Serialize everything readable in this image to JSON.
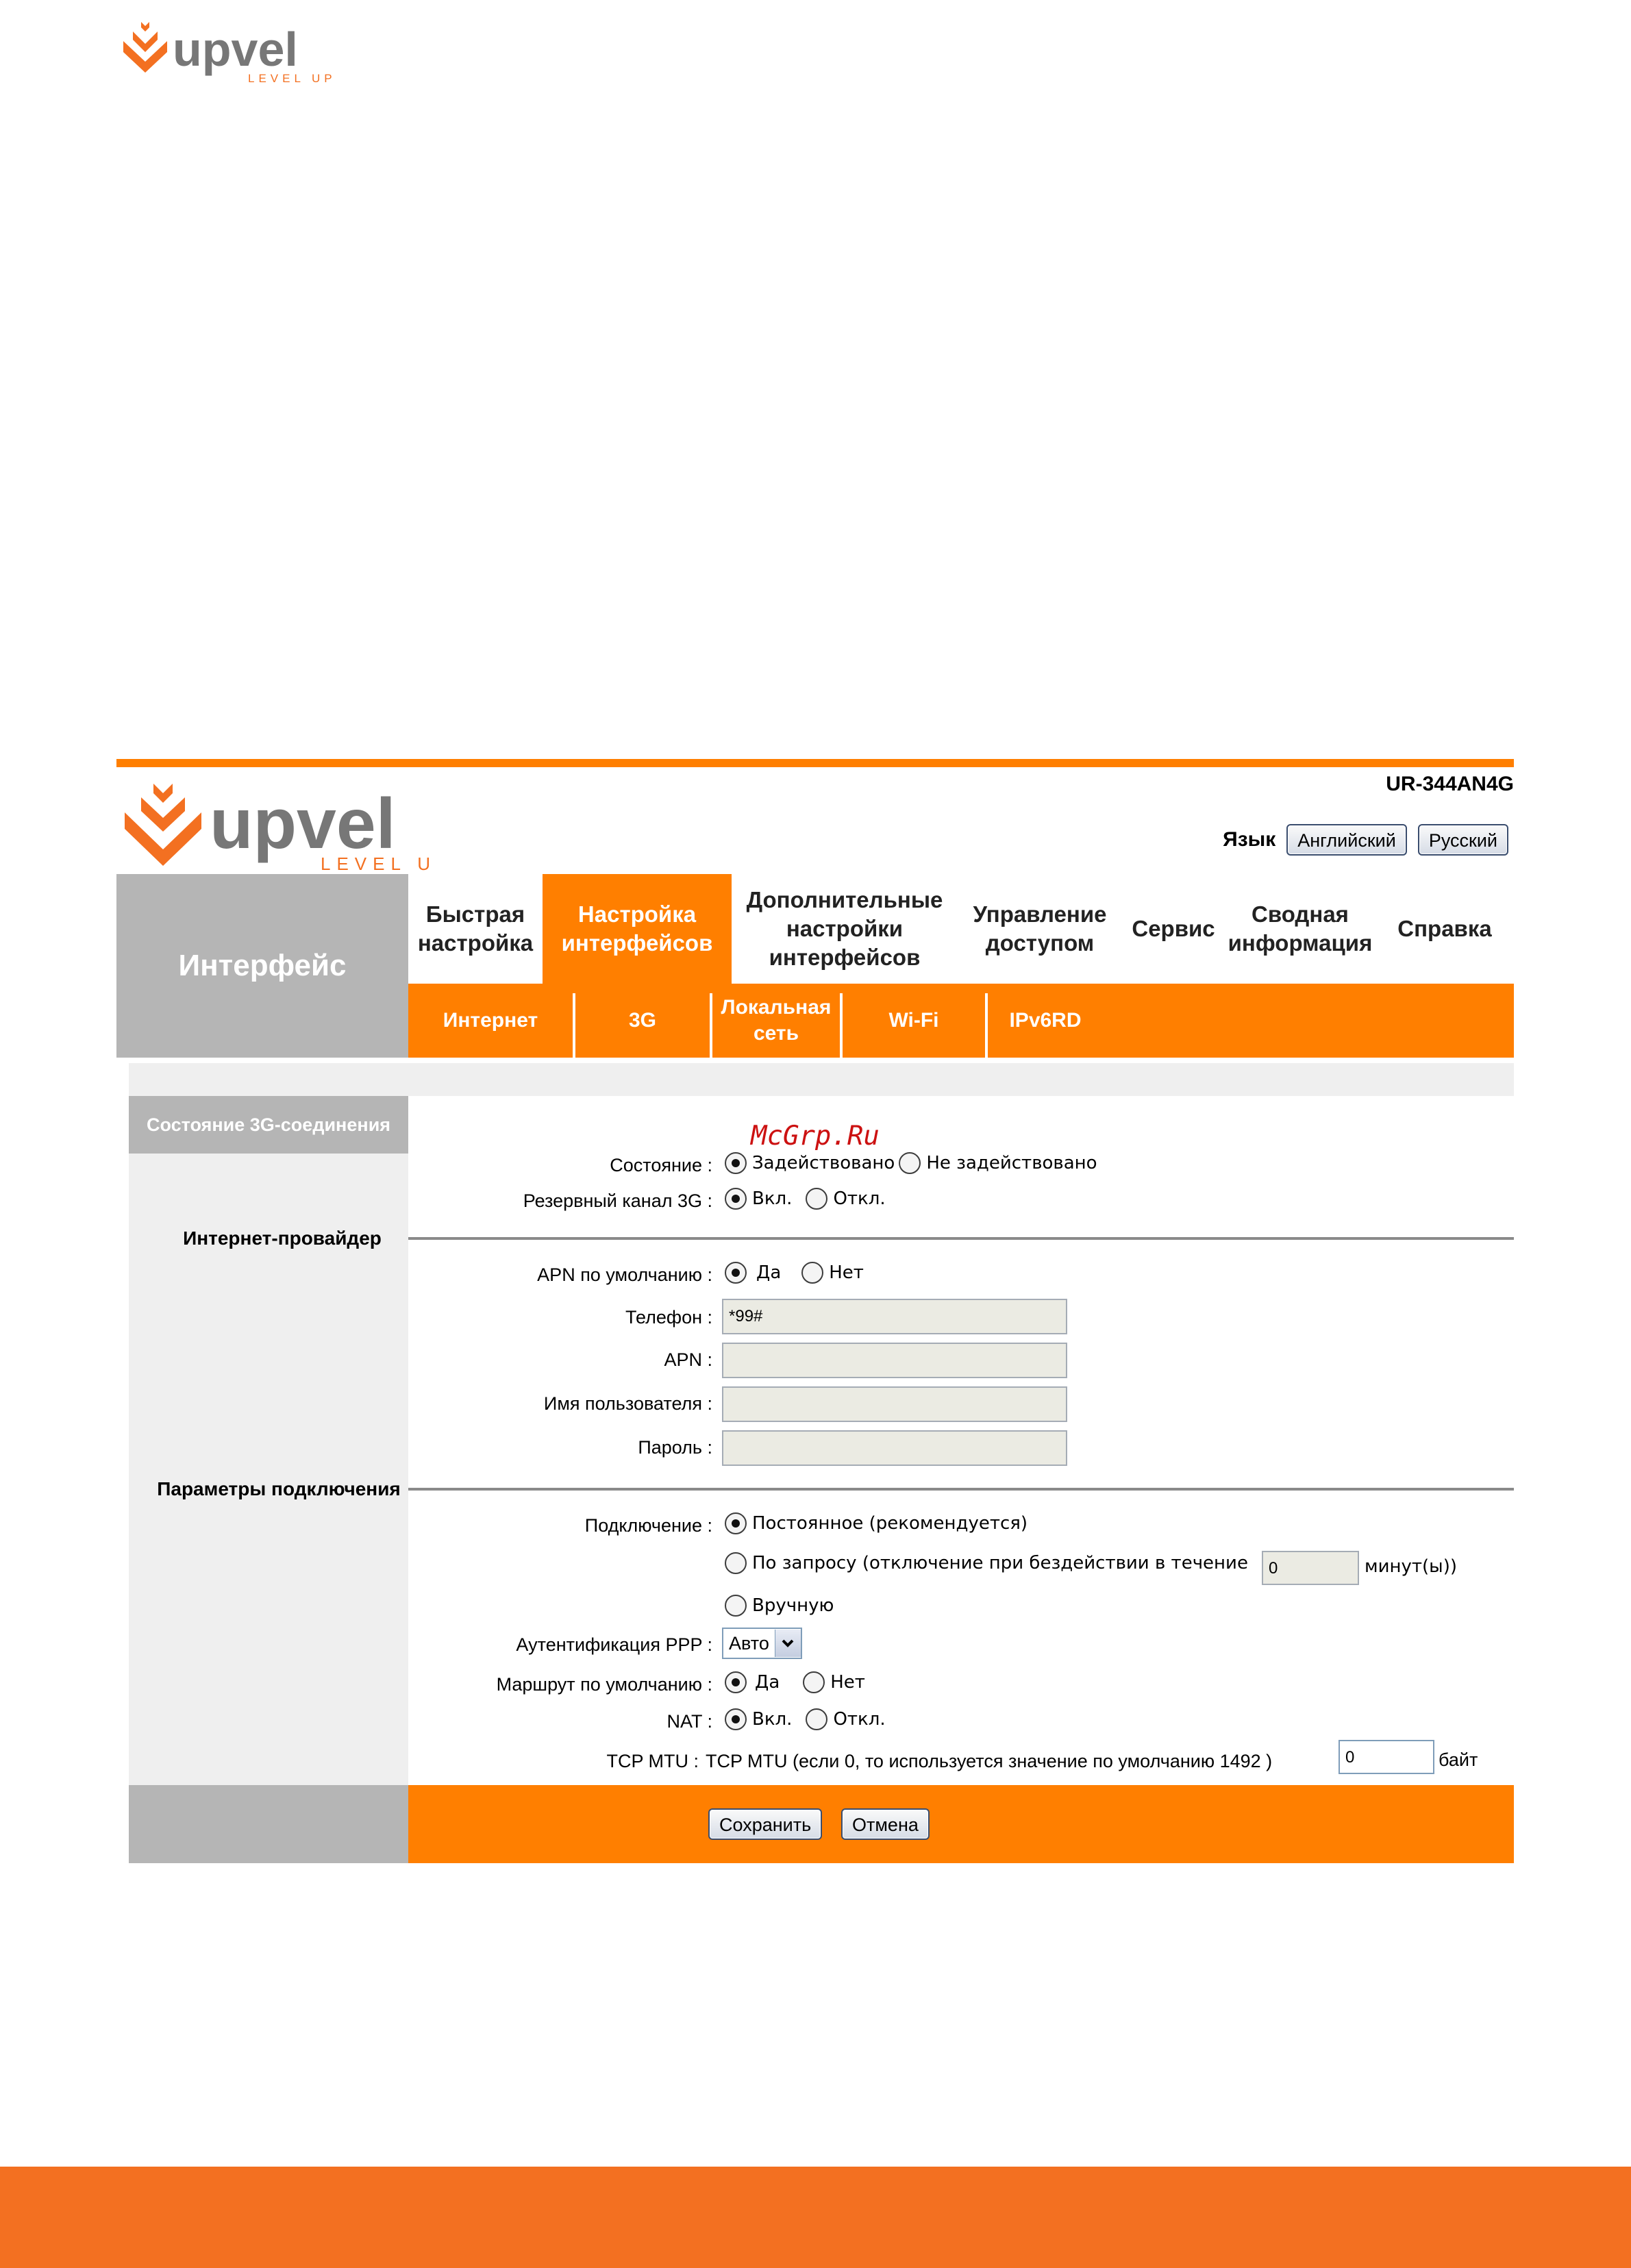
{
  "header": {
    "brand": "upvel",
    "tagline": "LEVEL UP"
  },
  "screenshot": {
    "model": "UR-344AN4G",
    "language": {
      "label": "Язык",
      "english_button": "Английский",
      "russian_button": "Русский"
    },
    "side_title": "Интерфейс",
    "menu": [
      {
        "label": "Быстрая\nнастройка",
        "active": false
      },
      {
        "label": "Настройка\nинтерфейсов",
        "active": true
      },
      {
        "label": "Дополнительные\nнастройки\nинтерфейсов",
        "active": false
      },
      {
        "label": "Управление\nдоступом",
        "active": false
      },
      {
        "label": "Сервис",
        "active": false
      },
      {
        "label": "Сводная\nинформация",
        "active": false
      },
      {
        "label": "Справка",
        "active": false
      }
    ],
    "submenu": [
      {
        "label": "Интернет"
      },
      {
        "label": "3G"
      },
      {
        "label": "Локальная\nсеть"
      },
      {
        "label": "Wi-Fi"
      },
      {
        "label": "IPv6RD"
      }
    ],
    "watermark": "McGrp.Ru",
    "sections": {
      "status": "Состояние 3G-соединения",
      "isp": "Интернет-провайдер",
      "connection": "Параметры подключения"
    },
    "status": {
      "state_label": "Состояние :",
      "state_on": "Задействовано",
      "state_off": "Не задействовано",
      "backup_label": "Резервный канал 3G :",
      "backup_on": "Вкл.",
      "backup_off": "Откл."
    },
    "isp": {
      "apn_default_label": "APN по умолчанию :",
      "yes": "Да",
      "no": "Нет",
      "phone_label": "Телефон :",
      "phone_value": "*99#",
      "apn_label": "APN :",
      "apn_value": "",
      "username_label": "Имя пользователя :",
      "username_value": "",
      "password_label": "Пароль :",
      "password_value": ""
    },
    "connection": {
      "connect_label": "Подключение :",
      "always": "Постоянное (рекомендуется)",
      "on_demand": "По запросу (отключение при бездействии в течение",
      "idle_value": "0",
      "minutes": "минут(ы))",
      "manual": "Вручную",
      "ppp_auth_label": "Аутентификация PPP :",
      "ppp_auth_value": "Авто",
      "default_route_label": "Маршрут по умолчанию :",
      "route_yes": "Да",
      "route_no": "Нет",
      "nat_label": "NAT :",
      "nat_on": "Вкл.",
      "nat_off": "Откл.",
      "mtu_label": "TCP MTU :",
      "mtu_hint": "TCP MTU (если 0, то используется значение по умолчанию 1492 )",
      "mtu_value": "0",
      "mtu_unit": "байт"
    },
    "buttons": {
      "save": "Сохранить",
      "cancel": "Отмена"
    }
  },
  "colors": {
    "accent": "#ff7f00",
    "gray": "#b5b5b5",
    "light_gray": "#efefef",
    "footer_bar": "#f37021"
  }
}
